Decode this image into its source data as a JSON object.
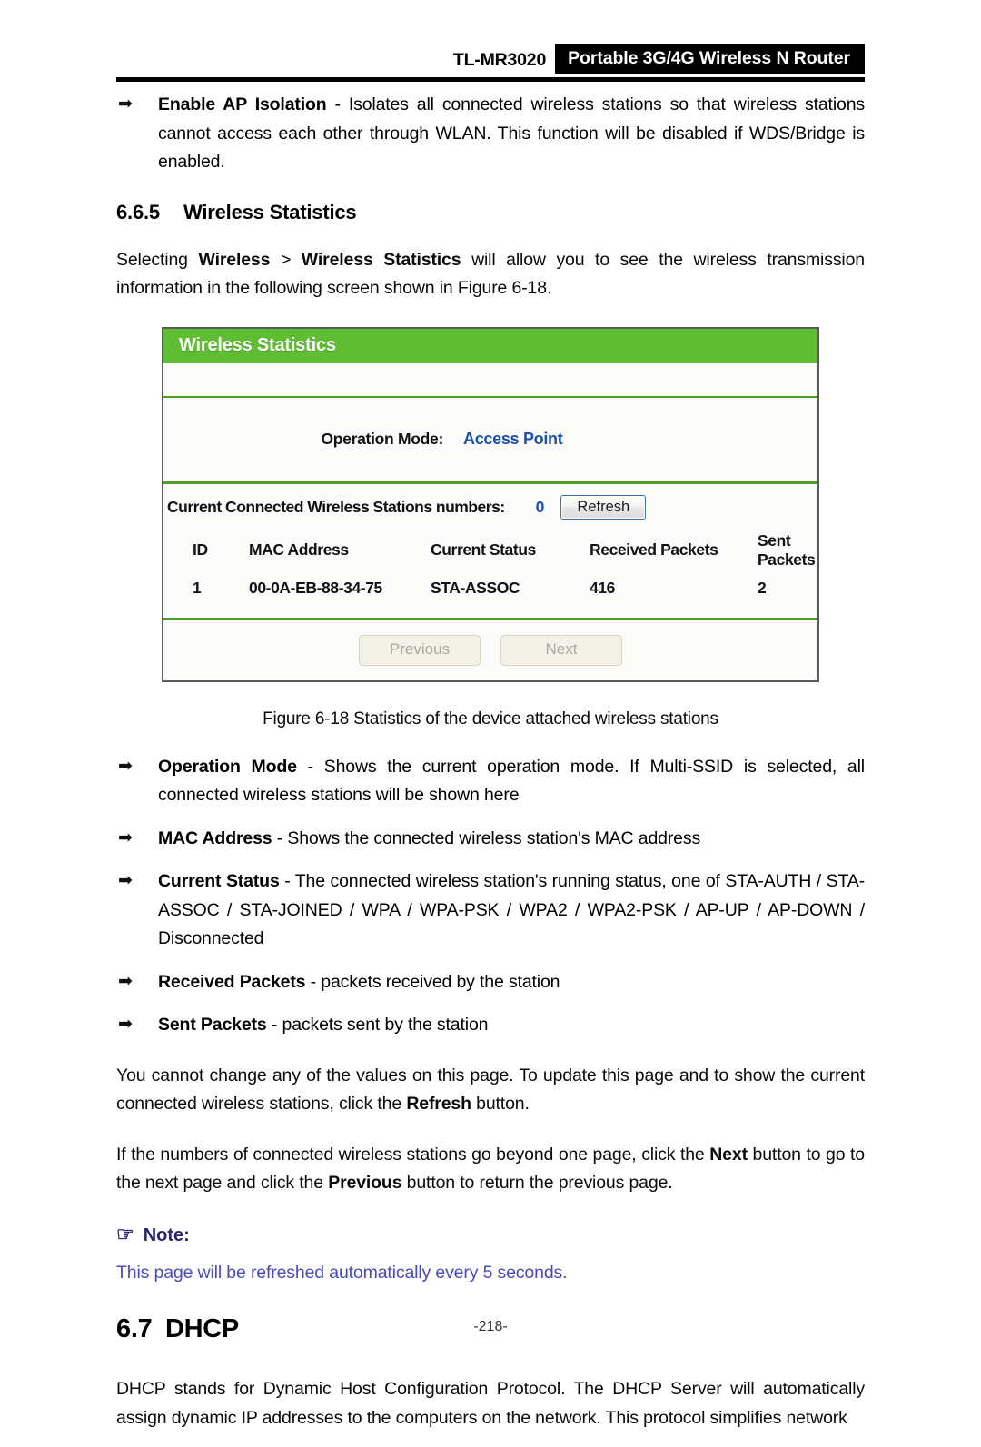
{
  "header": {
    "model": "TL-MR3020",
    "product": "Portable 3G/4G Wireless N Router"
  },
  "bullets_top": [
    {
      "term": "Enable AP Isolation",
      "dash": " - ",
      "text": "Isolates all connected wireless stations so that wireless stations cannot access each other through WLAN. This function will be disabled if WDS/Bridge is enabled."
    }
  ],
  "section": {
    "number": "6.6.5",
    "title": "Wireless Statistics",
    "intro_before": "Selecting ",
    "intro_bold1": "Wireless",
    "intro_mid": " > ",
    "intro_bold2": "Wireless Statistics",
    "intro_after": " will allow you to see the wireless transmission information in the following screen shown in Figure 6-18."
  },
  "router_panel": {
    "title": "Wireless Statistics",
    "operation_mode_label": "Operation Mode:",
    "operation_mode_value": "Access Point",
    "count_label": "Current Connected Wireless Stations numbers:",
    "count_value": "0",
    "refresh_button": "Refresh",
    "columns": [
      "ID",
      "MAC Address",
      "Current Status",
      "Received Packets",
      "Sent Packets"
    ],
    "rows": [
      {
        "id": "1",
        "mac": "00-0A-EB-88-34-75",
        "status": "STA-ASSOC",
        "received": "416",
        "sent": "2"
      }
    ],
    "previous_button": "Previous",
    "next_button": "Next",
    "colors": {
      "title_bar": "#5fbd31",
      "divider": "#4e9e2a",
      "value_blue": "#1d4fae",
      "panel_border": "#5b5b5b"
    }
  },
  "figure_caption": "Figure 6-18 Statistics of the device attached wireless stations",
  "bullets_main": [
    {
      "term": "Operation Mode",
      "dash": " - ",
      "text": "Shows the current operation mode. If Multi-SSID is selected, all connected wireless stations will be shown here"
    },
    {
      "term": "MAC Address",
      "dash": " - ",
      "text": "Shows the connected wireless station's MAC address"
    },
    {
      "term": "Current Status",
      "dash": " - ",
      "text": "The connected wireless station's running status, one of STA-AUTH / STA-ASSOC / STA-JOINED / WPA / WPA-PSK / WPA2 / WPA2-PSK / AP-UP / AP-DOWN / Disconnected"
    },
    {
      "term": "Received Packets",
      "dash": " - ",
      "text": "packets received by the station"
    },
    {
      "term": "Sent Packets",
      "dash": " - ",
      "text": "packets sent by the station"
    }
  ],
  "para_refresh": {
    "part1": "You cannot change any of the values on this page. To update this page and to show the current connected wireless stations, click the ",
    "bold": "Refresh",
    "part2": " button."
  },
  "para_paging": {
    "part1": "If the numbers of connected wireless stations go beyond one page, click the ",
    "bold1": "Next",
    "part2": " button to go to the next page and click the ",
    "bold2": "Previous",
    "part3": " button to return the previous page."
  },
  "note": {
    "icon": "pointing-hand-icon",
    "icon_glyph": "☞",
    "label": "Note:",
    "text": "This page will be refreshed automatically every 5 seconds.",
    "color": "#4a4ac0"
  },
  "chapter": {
    "number": "6.7",
    "title": "DHCP",
    "paragraph": "DHCP stands for Dynamic Host Configuration Protocol. The DHCP Server will automatically assign dynamic IP addresses to the computers on the network. This protocol simplifies network"
  },
  "footer": {
    "page_number": "-218-"
  }
}
